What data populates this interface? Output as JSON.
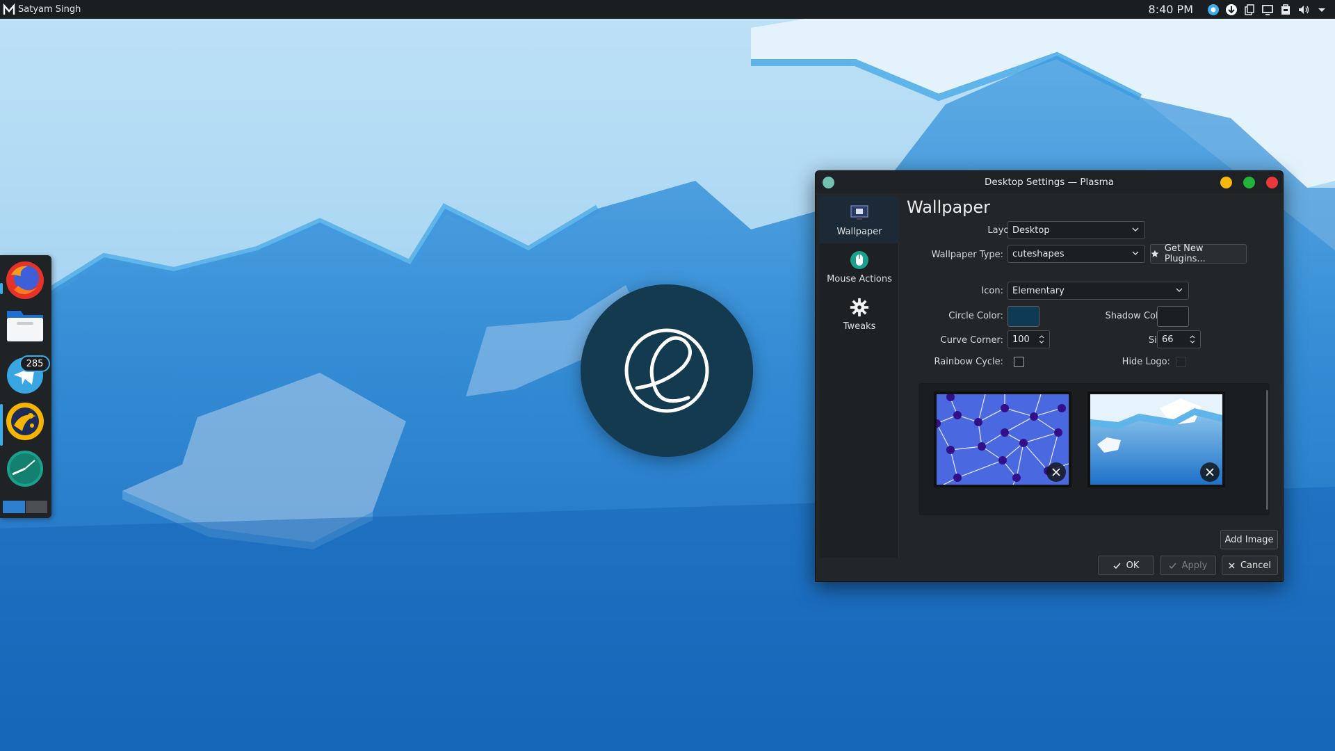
{
  "top_panel": {
    "user_name": "Satyam Singh",
    "clock": "8:40 PM",
    "tray_icons": [
      "network-icon",
      "download-icon",
      "clipboard-icon",
      "display-icon",
      "package-icon",
      "volume-icon",
      "menu-arrow-icon"
    ]
  },
  "dock": {
    "apps": [
      "firefox",
      "file-manager",
      "telegram",
      "lutris",
      "clock"
    ],
    "telegram_badge": "285"
  },
  "window": {
    "title": "Desktop Settings — Plasma",
    "nav": [
      {
        "label": "Wallpaper",
        "icon": "wallpaper-icon",
        "active": true
      },
      {
        "label": "Mouse Actions",
        "icon": "mouse-icon",
        "active": false
      },
      {
        "label": "Tweaks",
        "icon": "gear-icon",
        "active": false
      }
    ],
    "page_title": "Wallpaper",
    "form": {
      "layout_label": "Layout:",
      "layout_value": "Desktop",
      "wallpaper_type_label": "Wallpaper Type:",
      "wallpaper_type_value": "cuteshapes",
      "get_new_plugins": "Get New Plugins...",
      "icon_label": "Icon:",
      "icon_value": "Elementary",
      "circle_color_label": "Circle Color:",
      "circle_color": "#0f3a55",
      "shadow_color_label": "Shadow Color:",
      "shadow_color": "#1c1f22",
      "curve_corner_label": "Curve Corner:",
      "curve_corner_value": "100",
      "size_label": "Size:",
      "size_value": "66",
      "rainbow_cycle_label": "Rainbow Cycle:",
      "hide_logo_label": "Hide Logo:"
    },
    "thumbnails": [
      "network-pattern",
      "blue-hexagons"
    ],
    "add_image": "Add Image",
    "buttons": {
      "ok": "OK",
      "apply": "Apply",
      "cancel": "Cancel"
    }
  },
  "colors": {
    "panel": "#1b1e20",
    "accent": "#3daee9",
    "window_bg": "#232629",
    "min_button": "#f5b80f",
    "max_button": "#24b33a",
    "close_button": "#e8383d",
    "window_dot": "#73c2b0"
  }
}
